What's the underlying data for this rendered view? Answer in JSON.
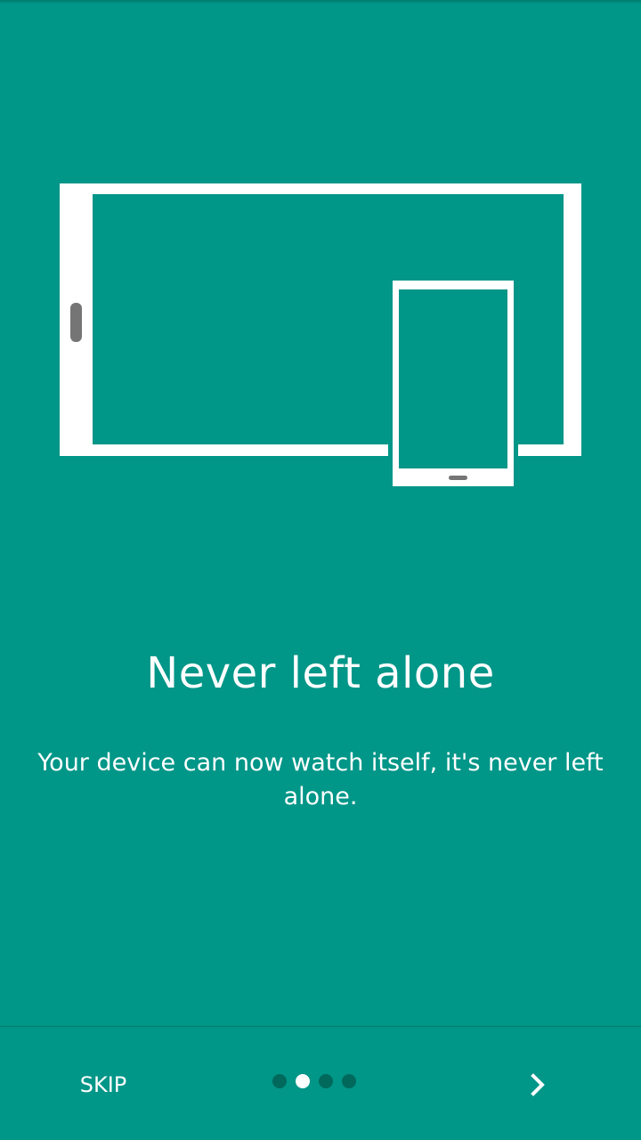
{
  "colors": {
    "background": "#009688",
    "foreground": "#ffffff",
    "inactive_dot": "#00695c",
    "divider": "#00796b"
  },
  "onboarding": {
    "title": "Never left alone",
    "description": "Your device can now watch itself, it's never left alone."
  },
  "footer": {
    "skip_label": "SKIP",
    "page_indicator": {
      "total": 4,
      "current": 2
    },
    "next_icon": "chevron-right-icon"
  },
  "illustration": {
    "icons": [
      "tablet-landscape-icon",
      "phone-portrait-icon"
    ]
  }
}
